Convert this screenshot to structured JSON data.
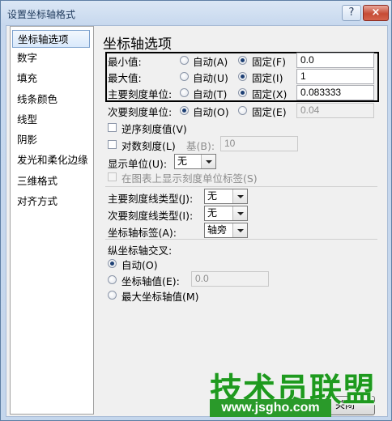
{
  "window": {
    "title": "设置坐标轴格式",
    "help_glyph": "?",
    "close_glyph": "×"
  },
  "sidebar": {
    "items": [
      "坐标轴选项",
      "数字",
      "填充",
      "线条颜色",
      "线型",
      "阴影",
      "发光和柔化边缘",
      "三维格式",
      "对齐方式"
    ],
    "selected": 0
  },
  "panel": {
    "heading": "坐标轴选项",
    "min": {
      "label": "最小值:",
      "auto": "自动(A)",
      "fixed": "固定(F)",
      "value": "0.0",
      "selected": "fixed"
    },
    "max": {
      "label": "最大值:",
      "auto": "自动(U)",
      "fixed": "固定(I)",
      "value": "1",
      "selected": "fixed"
    },
    "major": {
      "label": "主要刻度单位:",
      "auto": "自动(T)",
      "fixed": "固定(X)",
      "value": "0.083333",
      "selected": "fixed"
    },
    "minor": {
      "label": "次要刻度单位:",
      "auto": "自动(O)",
      "fixed": "固定(E)",
      "value": "0.04",
      "selected": "auto"
    },
    "reverse": {
      "label": "逆序刻度值(V)",
      "checked": false
    },
    "log": {
      "label": "对数刻度(L)",
      "base_label": "基(B):",
      "base_value": "10",
      "checked": false
    },
    "display_units": {
      "label": "显示单位(U):",
      "value": "无"
    },
    "show_units_label": {
      "label": "在图表上显示刻度单位标签(S)",
      "checked": false
    },
    "major_tick_type": {
      "label": "主要刻度线类型(J):",
      "value": "无"
    },
    "minor_tick_type": {
      "label": "次要刻度线类型(I):",
      "value": "无"
    },
    "axis_labels": {
      "label": "坐标轴标签(A):",
      "value": "轴旁"
    },
    "crosses": {
      "label": "纵坐标轴交叉:",
      "auto": "自动(O)",
      "axis_value": "坐标轴值(E):",
      "axis_value_input": "0.0",
      "max": "最大坐标轴值(M)",
      "selected": "auto"
    }
  },
  "footer": {
    "close_label": "关闭"
  },
  "watermark": {
    "text": "技术员联盟",
    "url": "www.jsgho.com"
  }
}
